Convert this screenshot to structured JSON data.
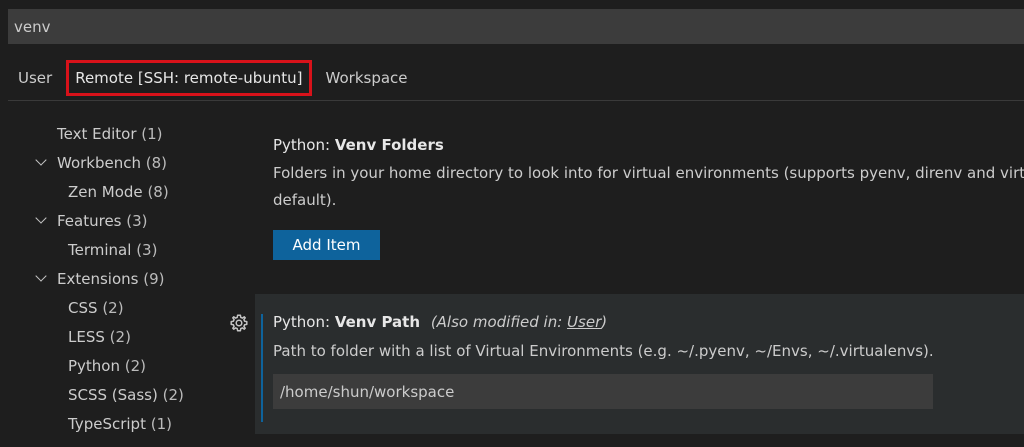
{
  "search": {
    "value": "venv"
  },
  "tabs": [
    {
      "label": "User"
    },
    {
      "label": "Remote [SSH: remote-ubuntu]",
      "highlight_color": "#d8121a"
    },
    {
      "label": "Workspace"
    }
  ],
  "toc": [
    {
      "label": "Text Editor",
      "count": "(1)",
      "expanded": false
    },
    {
      "label": "Workbench",
      "count": "(8)",
      "expanded": true
    },
    {
      "label": "Zen Mode",
      "count": "(8)"
    },
    {
      "label": "Features",
      "count": "(3)",
      "expanded": true
    },
    {
      "label": "Terminal",
      "count": "(3)"
    },
    {
      "label": "Extensions",
      "count": "(9)",
      "expanded": true
    },
    {
      "label": "CSS",
      "count": "(2)"
    },
    {
      "label": "LESS",
      "count": "(2)"
    },
    {
      "label": "Python",
      "count": "(2)"
    },
    {
      "label": "SCSS (Sass)",
      "count": "(2)"
    },
    {
      "label": "TypeScript",
      "count": "(1)"
    }
  ],
  "settings": {
    "venv_folders": {
      "category": "Python: ",
      "name": "Venv Folders",
      "description_line1": "Folders in your home directory to look into for virtual environments (supports pyenv, direnv and virt",
      "description_line2": "default).",
      "button_label": "Add Item"
    },
    "venv_path": {
      "category": "Python: ",
      "name": "Venv Path",
      "modified_prefix": "(Also modified in: ",
      "modified_link": "User",
      "modified_suffix": ")",
      "description": "Path to folder with a list of Virtual Environments (e.g. ~/.pyenv, ~/Envs, ~/.virtualenvs).",
      "value": "/home/shun/workspace"
    }
  },
  "colors": {
    "background": "#1e1e1e",
    "input_background": "#3c3c3c",
    "button": "#0e639c",
    "tab_highlight": "#d8121a",
    "focused_row": "#2a2d2e"
  }
}
